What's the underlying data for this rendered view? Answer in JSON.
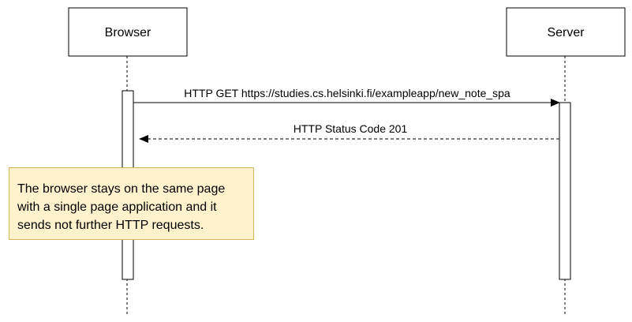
{
  "participants": {
    "browser": "Browser",
    "server": "Server"
  },
  "messages": [
    {
      "from": "Browser",
      "to": "Server",
      "label": "HTTP GET https://studies.cs.helsinki.fi/exampleapp/new_note_spa",
      "style": "solid"
    },
    {
      "from": "Server",
      "to": "Browser",
      "label": "HTTP Status Code 201",
      "style": "dashed"
    }
  ],
  "note": {
    "lines": [
      "The browser stays on the same page",
      "with a single page application and it",
      "sends not further HTTP requests."
    ]
  },
  "colors": {
    "note_fill": "#fff2cc",
    "note_border": "#d6b656",
    "line": "#000000"
  }
}
